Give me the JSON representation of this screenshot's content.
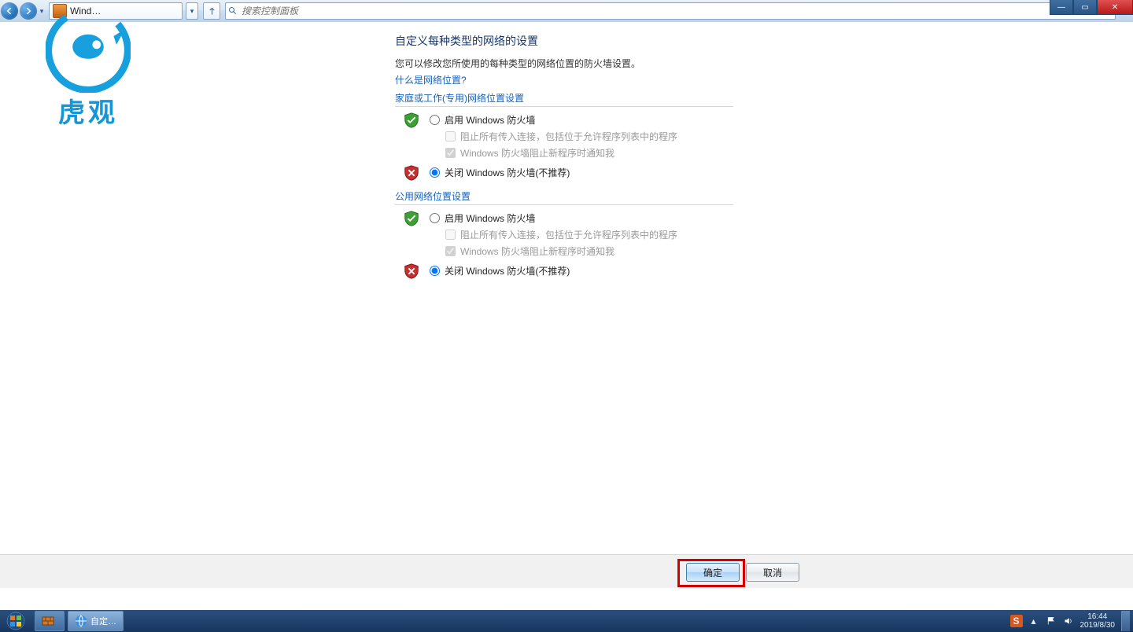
{
  "nav": {
    "breadcrumb": "Wind…",
    "search_placeholder": "搜索控制面板"
  },
  "page": {
    "title": "自定义每种类型的网络的设置",
    "subtitle": "您可以修改您所使用的每种类型的网络位置的防火墙设置。",
    "help_link": "什么是网络位置?"
  },
  "section_private": {
    "heading": "家庭或工作(专用)网络位置设置",
    "enable_label": "启用 Windows 防火墙",
    "block_all_label": "阻止所有传入连接，包括位于允许程序列表中的程序",
    "notify_label": "Windows 防火墙阻止新程序时通知我",
    "disable_label": "关闭 Windows 防火墙(不推荐)",
    "selected": "disable",
    "block_all_checked": false,
    "notify_checked": true
  },
  "section_public": {
    "heading": "公用网络位置设置",
    "enable_label": "启用 Windows 防火墙",
    "block_all_label": "阻止所有传入连接，包括位于允许程序列表中的程序",
    "notify_label": "Windows 防火墙阻止新程序时通知我",
    "disable_label": "关闭 Windows 防火墙(不推荐)",
    "selected": "disable",
    "block_all_checked": false,
    "notify_checked": true
  },
  "buttons": {
    "ok": "确定",
    "cancel": "取消"
  },
  "taskbar": {
    "task1": "自定…",
    "time": "16:44",
    "date": "2019/8/30",
    "sogou": "S"
  },
  "watermark": {
    "text": "虎观"
  }
}
